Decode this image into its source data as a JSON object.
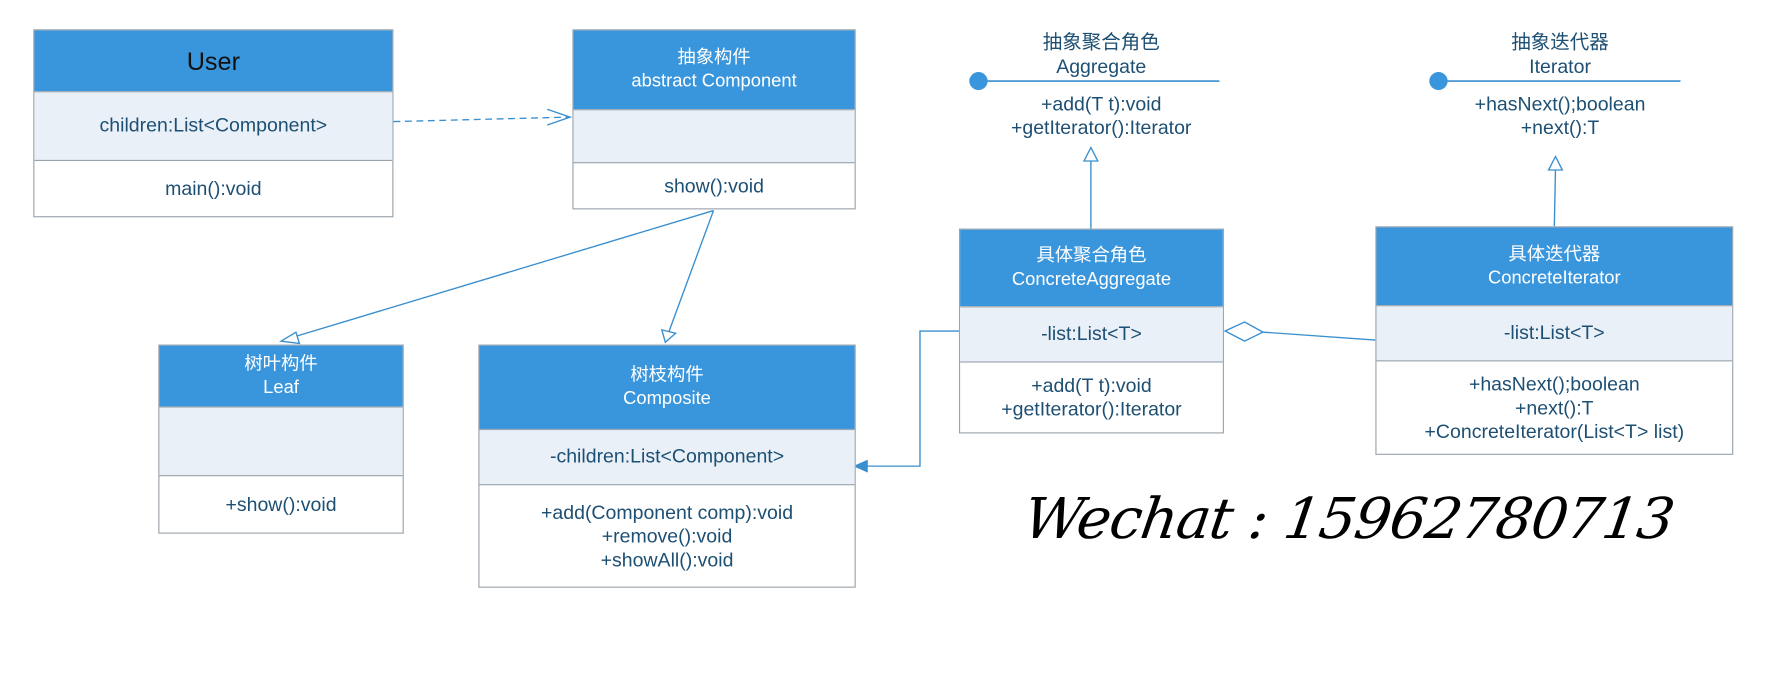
{
  "classes": {
    "user": {
      "name": "User",
      "attribute": "children:List<Component>",
      "operations": [
        "main():void"
      ]
    },
    "component": {
      "name_cn": "抽象构件",
      "name_en": "abstract Component",
      "attribute": "",
      "operations": [
        "show():void"
      ]
    },
    "leaf": {
      "name_cn": "树叶构件",
      "name_en": "Leaf",
      "attribute": "",
      "operations": [
        "+show():void"
      ]
    },
    "composite": {
      "name_cn": "树枝构件",
      "name_en": "Composite",
      "attribute": "-children:List<Component>",
      "operations": [
        "+add(Component comp):void",
        "+remove():void",
        "+showAll():void"
      ]
    },
    "concrete_aggregate": {
      "name_cn": "具体聚合角色",
      "name_en": "ConcreteAggregate",
      "attribute": "-list:List<T>",
      "operations": [
        "+add(T t):void",
        "+getIterator():Iterator"
      ]
    },
    "concrete_iterator": {
      "name_cn": "具体迭代器",
      "name_en": "ConcreteIterator",
      "attribute": "-list:List<T>",
      "operations": [
        "+hasNext();boolean",
        "+next():T",
        "+ConcreteIterator(List<T> list)"
      ]
    }
  },
  "interfaces": {
    "aggregate": {
      "name_cn": "抽象聚合角色",
      "name_en": "Aggregate",
      "operations": [
        "+add(T t):void",
        "+getIterator():Iterator"
      ]
    },
    "iterator": {
      "name_cn": "抽象迭代器",
      "name_en": "Iterator",
      "operations": [
        "+hasNext();boolean",
        "+next():T"
      ]
    }
  },
  "watermark": "Wechat : 15962780713",
  "colors": {
    "header": "#3a96dc",
    "attr_bg": "#e9f0f8",
    "border": "#9aa3ab",
    "text": "#1d4f73",
    "line": "#3a8fcf"
  }
}
